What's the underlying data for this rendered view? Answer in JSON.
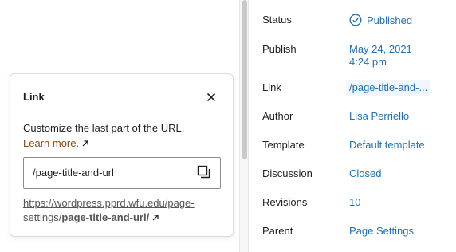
{
  "popover": {
    "title": "Link",
    "help_text": "Customize the last part of the URL.",
    "learn_more": "Learn more.",
    "slug_value": "/page-title-and-url",
    "url_base": "https://wordpress.pprd.wfu.edu/page-settings/",
    "url_slug": "page-title-and-url/"
  },
  "settings": {
    "status_label": "Status",
    "status_value": "Published",
    "publish_label": "Publish",
    "publish_date": "May 24, 2021",
    "publish_time": "4:24 pm",
    "link_label": "Link",
    "link_value": "/page-title-and-...",
    "author_label": "Author",
    "author_value": "Lisa Perriello",
    "template_label": "Template",
    "template_value": "Default template",
    "discussion_label": "Discussion",
    "discussion_value": "Closed",
    "revisions_label": "Revisions",
    "revisions_value": "10",
    "parent_label": "Parent",
    "parent_value": "Page Settings"
  },
  "colors": {
    "accent": "#2271b1",
    "learn_more": "#8a4a12"
  },
  "icons": [
    "close-icon",
    "external-link-icon",
    "copy-icon",
    "published-check-icon"
  ]
}
